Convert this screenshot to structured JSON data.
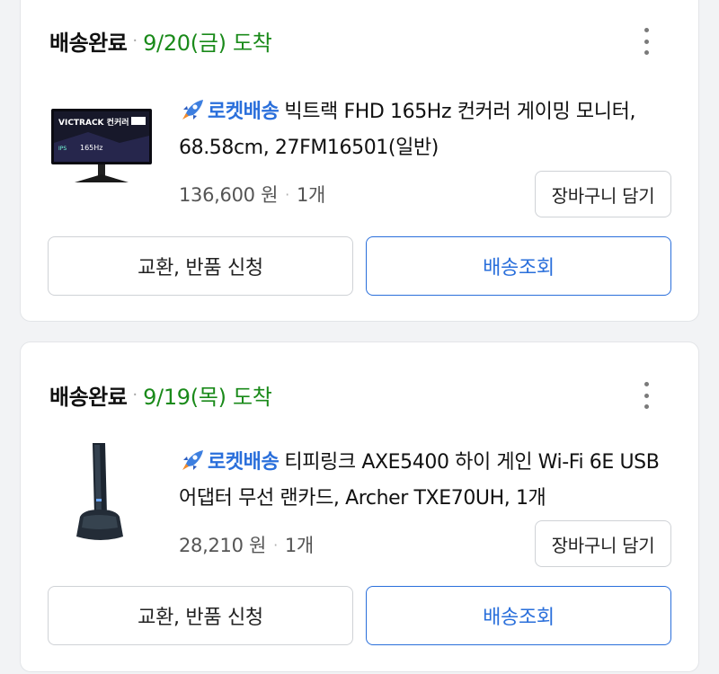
{
  "orders": [
    {
      "status": "배송완료",
      "separator": "·",
      "arrival": "9/20(금) 도착",
      "rocket_label": "로켓배송",
      "title": "빅트랙 FHD 165Hz 컨커러 게이밍 모니터, 68.58cm, 27FM16501(일반)",
      "price": "136,600 원",
      "quantity": "1개",
      "cart_button": "장바구니 담기",
      "return_button": "교환, 반품 신청",
      "track_button": "배송조회",
      "thumb_text": "VICTRACK 컨커러",
      "thumb_sub": "165Hz"
    },
    {
      "status": "배송완료",
      "separator": "·",
      "arrival": "9/19(목) 도착",
      "rocket_label": "로켓배송",
      "title": "티피링크 AXE5400 하이 게인 Wi-Fi 6E USB 어댑터 무선 랜카드, Archer TXE70UH, 1개",
      "price": "28,210 원",
      "quantity": "1개",
      "cart_button": "장바구니 담기",
      "return_button": "교환, 반품 신청",
      "track_button": "배송조회"
    }
  ],
  "colors": {
    "arrival_green": "#1a8a1a",
    "rocket_blue": "#2a6fdb",
    "page_bg": "#f2f3f5"
  },
  "icons": {
    "menu": "kebab-icon",
    "rocket": "rocket-icon"
  }
}
